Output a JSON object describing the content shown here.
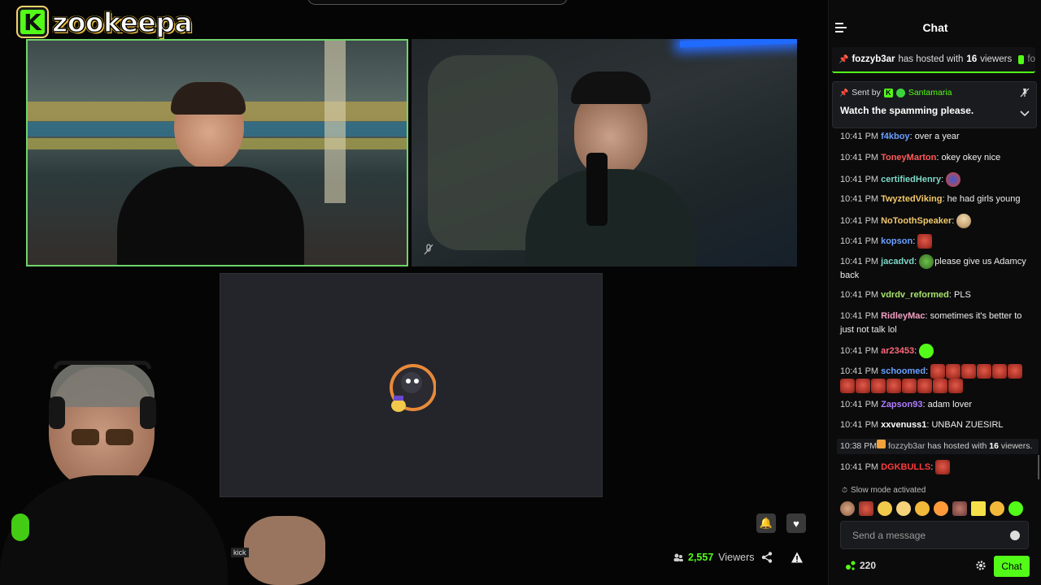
{
  "brand": {
    "name": "zookeepa",
    "logo_letter": "K",
    "accent": "#53fc18"
  },
  "stream": {
    "overlay_label": "kick",
    "viewers": {
      "count": "2,557",
      "label": "Viewers"
    }
  },
  "chat": {
    "title": "Chat",
    "host_banner": {
      "user": "fozzyb3ar",
      "text_before": "has hosted with",
      "viewers": "16",
      "text_after": "viewers",
      "trail": "fo"
    },
    "pinned": {
      "sent_by_label": "Sent by",
      "moderator": "Santamaria",
      "message": "Watch the spamming please."
    },
    "messages": [
      {
        "time": "10:41 PM",
        "user": "f4kboy",
        "color": "#6aa0ff",
        "text": "over a year"
      },
      {
        "time": "10:41 PM",
        "user": "ToneyMarton",
        "color": "#ff5a5a",
        "text": "okey okey nice"
      },
      {
        "time": "10:41 PM",
        "user": "certifiedHenry",
        "color": "#7ed9c7",
        "text": "",
        "emotes": [
          "em-blue"
        ]
      },
      {
        "time": "10:41 PM",
        "user": "TwyztedViking",
        "color": "#f2c96a",
        "text": "he had girls young"
      },
      {
        "time": "10:41 PM",
        "user": "NoToothSpeaker",
        "color": "#f2c96a",
        "text": "",
        "emotes": [
          "em-bald"
        ]
      },
      {
        "time": "10:41 PM",
        "user": "kopson",
        "color": "#6aa0ff",
        "text": "",
        "emotes": [
          "em-face"
        ]
      },
      {
        "time": "10:41 PM",
        "user": "jacadvd",
        "color": "#7ed9c7",
        "text": "please give us Adamcy back",
        "emotes": [
          "em-pepe"
        ]
      },
      {
        "time": "10:41 PM",
        "user": "vdrdv_reformed",
        "color": "#a8e36a",
        "text": "PLS"
      },
      {
        "time": "10:41 PM",
        "user": "RidleyMac",
        "color": "#f0a0c0",
        "text": "sometimes it's better to just not talk lol"
      },
      {
        "time": "10:41 PM",
        "user": "ar23453",
        "color": "#ff6a7a",
        "text": "",
        "emotes": [
          "em-green"
        ]
      },
      {
        "time": "10:41 PM",
        "user": "schoomed",
        "color": "#6aa0ff",
        "text": "",
        "emotes": [
          "em-face",
          "em-face",
          "em-face",
          "em-face",
          "em-face",
          "em-face",
          "em-face",
          "em-face",
          "em-face",
          "em-face",
          "em-face",
          "em-face",
          "em-face",
          "em-face"
        ]
      },
      {
        "time": "10:41 PM",
        "user": "Zapson93",
        "color": "#b07bff",
        "text": "adam lover"
      },
      {
        "time": "10:41 PM",
        "user": "xxvenuss1",
        "color": "#ffffff",
        "text": "UNBAN ZUESIRL"
      },
      {
        "time": "10:38 PM",
        "user": "fozzyb3ar",
        "color": "#ffffff",
        "text": "has hosted with",
        "host_viewers": "16",
        "host_tail": "viewers.",
        "is_host": true
      },
      {
        "time": "10:41 PM",
        "user": "DGKBULLS",
        "color": "#ff3a3a",
        "text": "",
        "emotes": [
          "em-face"
        ]
      }
    ],
    "slow_mode": "Slow mode activated",
    "input": {
      "placeholder": "Send a message"
    },
    "points": "220",
    "send_label": "Chat"
  }
}
